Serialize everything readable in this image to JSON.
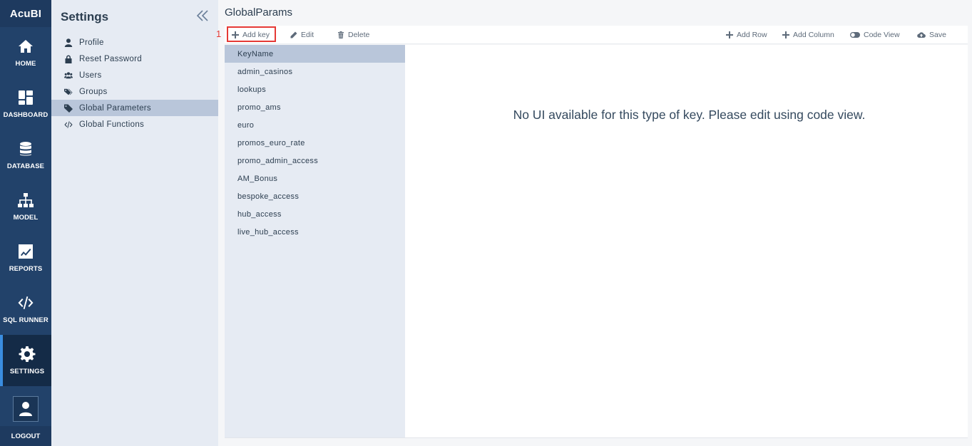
{
  "app": {
    "brand": "AcuBI"
  },
  "rail": {
    "items": [
      {
        "label": "HOME",
        "icon": "home-icon"
      },
      {
        "label": "DASHBOARD",
        "icon": "dashboard-icon"
      },
      {
        "label": "DATABASE",
        "icon": "database-icon"
      },
      {
        "label": "MODEL",
        "icon": "sitemap-icon"
      },
      {
        "label": "REPORTS",
        "icon": "chart-icon"
      },
      {
        "label": "SQL RUNNER",
        "icon": "code-icon"
      },
      {
        "label": "SETTINGS",
        "icon": "gear-icon",
        "active": true
      }
    ],
    "logout": "LOGOUT"
  },
  "settings": {
    "title": "Settings",
    "menu": [
      {
        "label": "Profile",
        "icon": "user-icon"
      },
      {
        "label": "Reset Password",
        "icon": "lock-icon"
      },
      {
        "label": "Users",
        "icon": "users-icon"
      },
      {
        "label": "Groups",
        "icon": "tags-icon"
      },
      {
        "label": "Global Parameters",
        "icon": "tag-icon",
        "active": true
      },
      {
        "label": "Global Functions",
        "icon": "code-icon"
      }
    ]
  },
  "main": {
    "title": "GlobalParams",
    "toolbar": {
      "add_key": "Add key",
      "edit": "Edit",
      "delete": "Delete",
      "add_row": "Add Row",
      "add_column": "Add Column",
      "code_view": "Code View",
      "save": "Save"
    },
    "annotation": {
      "step": "1",
      "color": "#e53935"
    },
    "keys": {
      "header": "KeyName",
      "rows": [
        "admin_casinos",
        "lookups",
        "promo_ams",
        "euro",
        "promos_euro_rate",
        "promo_admin_access",
        "AM_Bonus",
        "bespoke_access",
        "hub_access",
        "live_hub_access"
      ]
    },
    "message": "No UI available for this type of key. Please edit using code view."
  },
  "colors": {
    "rail": "#22426a",
    "panel": "#e6ebf3",
    "selected": "#b9c6da",
    "accent": "#3a8de0"
  }
}
